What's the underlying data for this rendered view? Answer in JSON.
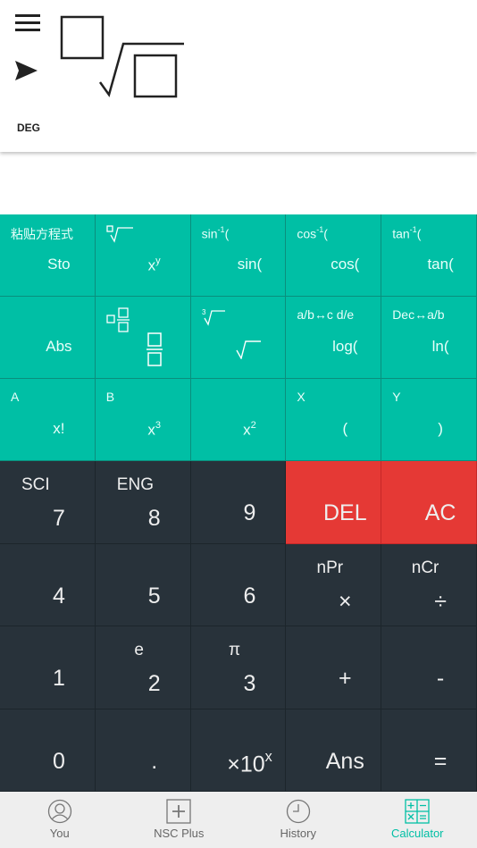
{
  "top": {
    "angle_mode": "DEG"
  },
  "colors": {
    "teal": "#00BFA5",
    "dark": "#28323a",
    "red": "#E53935"
  },
  "function_rows": [
    [
      {
        "sec": "粘贴方程式",
        "pri": "Sto"
      },
      {
        "sec_icon": "nth-root",
        "pri": "x",
        "pri_sup": "y"
      },
      {
        "sec": "sin",
        "sec_sup": "-1",
        "sec_tail": "(",
        "pri": "sin("
      },
      {
        "sec": "cos",
        "sec_sup": "-1",
        "sec_tail": "(",
        "pri": "cos("
      },
      {
        "sec": "tan",
        "sec_sup": "-1",
        "sec_tail": "(",
        "pri": "tan("
      }
    ],
    [
      {
        "pri": "Abs"
      },
      {
        "sec_icon": "mixed-fraction",
        "pri_icon": "fraction"
      },
      {
        "sec_icon": "cube-root",
        "pri_icon": "square-root"
      },
      {
        "sec": "a/b↔c d/e",
        "pri": "log("
      },
      {
        "sec": "Dec↔a/b",
        "pri": "ln("
      }
    ],
    [
      {
        "sec": "A",
        "pri": "x!"
      },
      {
        "sec": "B",
        "pri": "x",
        "pri_sup": "3"
      },
      {
        "pri": "x",
        "pri_sup": "2"
      },
      {
        "sec": "X",
        "pri": "("
      },
      {
        "sec": "Y",
        "pri": ")"
      }
    ]
  ],
  "number_rows": [
    [
      {
        "sec": "SCI",
        "pri": "7"
      },
      {
        "sec": "ENG",
        "pri": "8"
      },
      {
        "pri": "9"
      },
      {
        "pri": "DEL",
        "red": true
      },
      {
        "pri": "AC",
        "red": true
      }
    ],
    [
      {
        "pri": "4"
      },
      {
        "pri": "5"
      },
      {
        "pri": "6"
      },
      {
        "sec": "nPr",
        "pri": "×"
      },
      {
        "sec": "nCr",
        "pri": "÷"
      }
    ],
    [
      {
        "pri": "1"
      },
      {
        "sec": "e",
        "pri": "2"
      },
      {
        "sec": "π",
        "pri": "3"
      },
      {
        "pri": "+"
      },
      {
        "pri": "-"
      }
    ],
    [
      {
        "pri": "0"
      },
      {
        "pri": "."
      },
      {
        "pri": "×10",
        "pri_sup": "x"
      },
      {
        "pri": "Ans"
      },
      {
        "pri": "="
      }
    ]
  ],
  "nav": [
    {
      "label": "You",
      "icon": "user-icon"
    },
    {
      "label": "NSC Plus",
      "icon": "plus-box-icon"
    },
    {
      "label": "History",
      "icon": "clock-icon"
    },
    {
      "label": "Calculator",
      "icon": "calculator-icon"
    }
  ]
}
